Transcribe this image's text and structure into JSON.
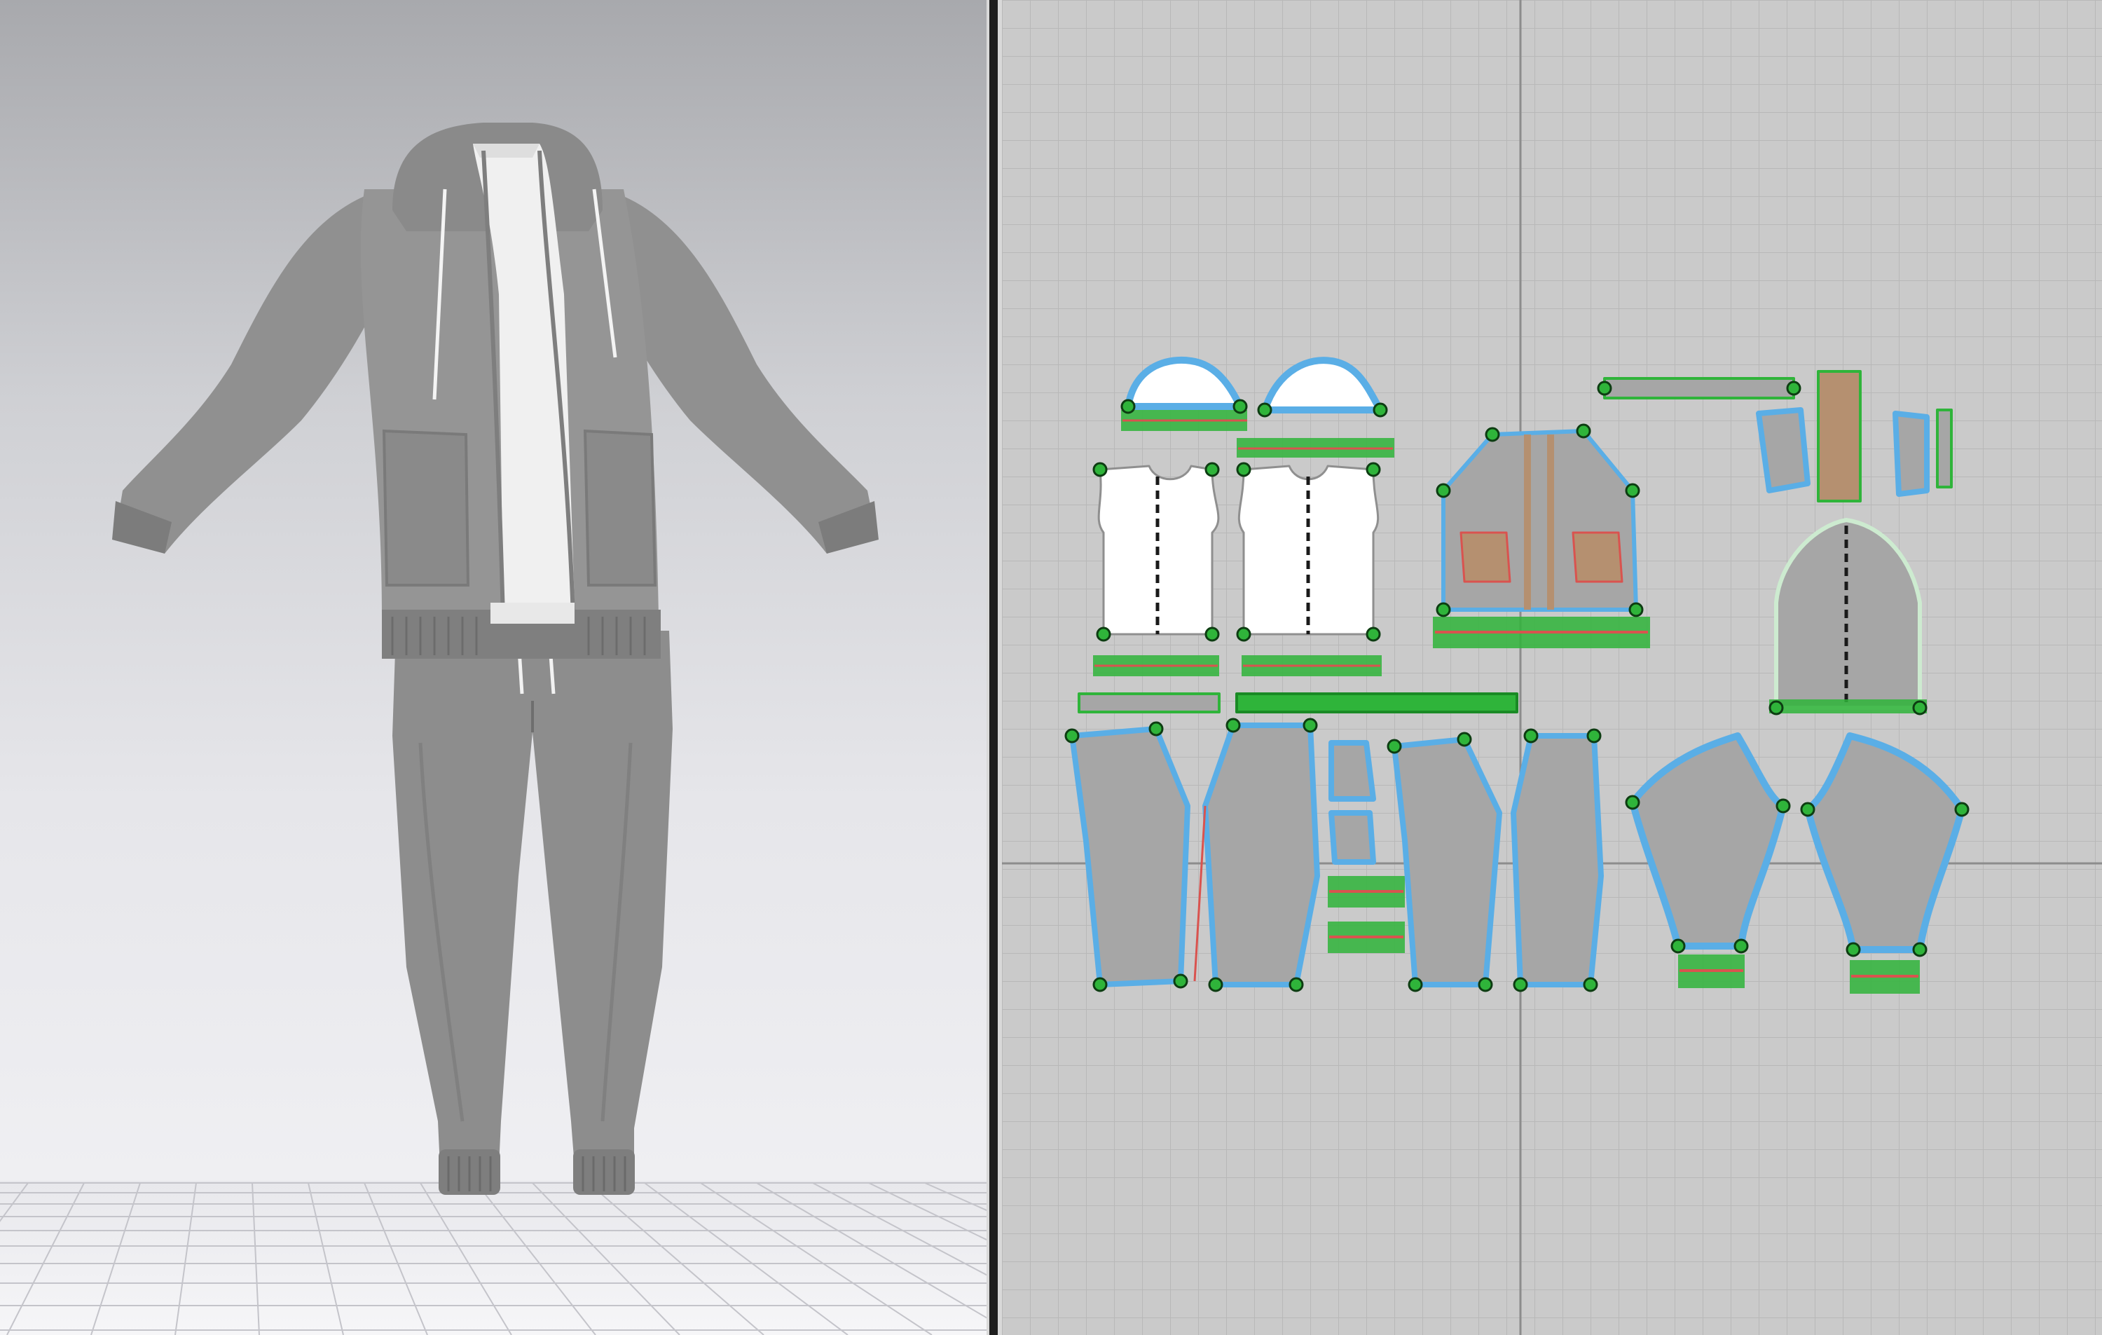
{
  "app": {
    "views": [
      {
        "id": "3d",
        "content": "avatar-garment"
      },
      {
        "id": "2d",
        "content": "pattern-layout"
      }
    ]
  },
  "colors": {
    "viewport_3d_top": "#a8a9ad",
    "viewport_3d_bottom": "#f3f3f6",
    "viewport_2d_bg": "#cacaca",
    "garment_gray": "#8f8f8f",
    "pattern_fill": "#a6a6a6",
    "pattern_fill_white": "#ffffff",
    "pocket_fill": "#b59070",
    "seam_blue": "#5aaee6",
    "point_green": "#2fb43a",
    "seam_red": "#d9534f",
    "divider_dark": "#1e1e1e"
  },
  "icons": [
    "grid-floor",
    "pattern-point",
    "seam-line",
    "internal-line"
  ]
}
